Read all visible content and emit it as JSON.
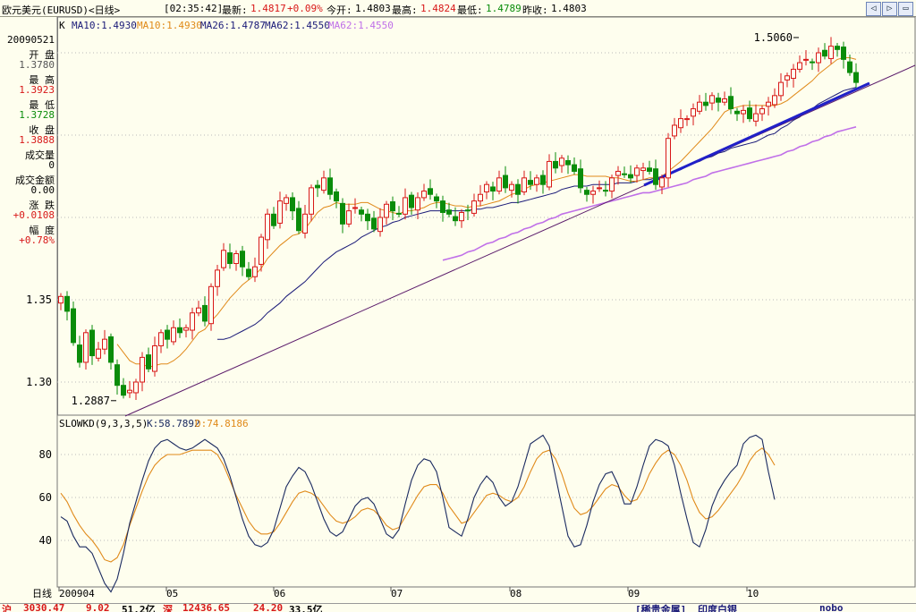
{
  "titlebar": {
    "title": "欧元美元(EURUSD)<日线>",
    "time": "[02:35:42]",
    "latest_label": "最新:",
    "latest_value": "1.4817",
    "change": "+0.09%",
    "open_label": "今开:",
    "open_value": "1.4803",
    "high_label": "最高:",
    "high_value": "1.4824",
    "low_label": "最低:",
    "low_value": "1.4789",
    "prev_label": "昨收:",
    "prev_value": "1.4803",
    "btn_back": "◁",
    "btn_fwd": "▷",
    "btn_close": "▭"
  },
  "legend": {
    "k": "K",
    "ma10a": "MA10:1.4930",
    "ma10b": "MA10:1.4930",
    "ma26": "MA26:1.4787",
    "ma62a": "MA62:1.4550",
    "ma62b": "MA62:1.4550"
  },
  "side": {
    "date": "20090521",
    "open_label": "开 盘",
    "open_value": "1.3780",
    "high_label": "最 高",
    "high_value": "1.3923",
    "low_label": "最 低",
    "low_value": "1.3728",
    "close_label": "收 盘",
    "close_value": "1.3888",
    "vol_label": "成交量",
    "vol_value": "0",
    "amount_label": "成交金额",
    "amount_value": "0.00",
    "change_label": "涨 跌",
    "change_value": "+0.0108",
    "range_label": "幅 度",
    "range_value": "+0.78%"
  },
  "indicator": {
    "name": "SLOWKD(9,3,3,5)",
    "k": "K:58.7892",
    "d": "D:74.8186"
  },
  "footer": {
    "axis_label": "日线",
    "months": [
      "200904",
      "05",
      "06",
      "07",
      "08",
      "09",
      "10"
    ]
  },
  "statusbar": {
    "a": "沪",
    "b": "3030.47",
    "c": "9.02",
    "d": "51.2亿",
    "e": "深",
    "f": "12436.65",
    "g": "24.20",
    "h": "33.5亿",
    "i": "[稀贵金属]",
    "j": "印度白银",
    "k": "nobo"
  },
  "colors": {
    "background": "#FEFEEE",
    "up": "#D81818",
    "down": "#0A8C0A",
    "ma10": "#E08A1A",
    "ma26": "#1A1A78",
    "ma62": "#C070E8",
    "kline": "#1A2A60",
    "dline": "#E08A1A",
    "trendline": "#2020C8"
  },
  "chart_data": [
    {
      "type": "candlestick",
      "title": "欧元美元(EURUSD)<日线>",
      "y_ticks": [
        1.3,
        1.35
      ],
      "y_tick_labels": [
        "1.30",
        "1.35"
      ],
      "ylim": [
        1.28,
        1.52
      ],
      "month_labels": [
        "200904",
        "05",
        "06",
        "07",
        "08",
        "09",
        "10"
      ],
      "annotations": [
        {
          "text": "1.5060",
          "value": 1.506,
          "index": 118
        },
        {
          "text": "1.2887",
          "value": 1.2887,
          "index": 9
        }
      ],
      "closes": [
        1.352,
        1.343,
        1.324,
        1.312,
        1.33,
        1.316,
        1.32,
        1.326,
        1.312,
        1.298,
        1.292,
        1.295,
        1.3,
        1.315,
        1.308,
        1.322,
        1.33,
        1.326,
        1.333,
        1.33,
        1.333,
        1.342,
        1.345,
        1.337,
        1.358,
        1.368,
        1.38,
        1.372,
        1.378,
        1.37,
        1.364,
        1.37,
        1.388,
        1.402,
        1.395,
        1.41,
        1.412,
        1.404,
        1.392,
        1.402,
        1.418,
        1.418,
        1.424,
        1.414,
        1.41,
        1.396,
        1.404,
        1.406,
        1.402,
        1.398,
        1.393,
        1.4,
        1.408,
        1.404,
        1.402,
        1.412,
        1.406,
        1.412,
        1.416,
        1.414,
        1.41,
        1.403,
        1.402,
        1.398,
        1.403,
        1.404,
        1.41,
        1.414,
        1.42,
        1.416,
        1.424,
        1.418,
        1.42,
        1.414,
        1.424,
        1.42,
        1.424,
        1.42,
        1.434,
        1.43,
        1.436,
        1.432,
        1.428,
        1.418,
        1.414,
        1.416,
        1.418,
        1.416,
        1.424,
        1.428,
        1.426,
        1.424,
        1.43,
        1.43,
        1.428,
        1.42,
        1.424,
        1.448,
        1.456,
        1.46,
        1.46,
        1.466,
        1.47,
        1.468,
        1.474,
        1.47,
        1.472,
        1.466,
        1.463,
        1.465,
        1.46,
        1.463,
        1.466,
        1.47,
        1.474,
        1.482,
        1.486,
        1.49,
        1.494,
        1.496,
        1.494,
        1.5,
        1.498,
        1.504,
        1.502,
        1.496,
        1.488,
        1.482
      ],
      "ma10": [
        null,
        null,
        null,
        null,
        null,
        null,
        null,
        null,
        null,
        1.323,
        1.318,
        1.313,
        1.311,
        1.311,
        1.309,
        1.31,
        1.311,
        1.311,
        1.313,
        1.316,
        1.32,
        1.325,
        1.33,
        1.332,
        1.337,
        1.341,
        1.346,
        1.351,
        1.355,
        1.359,
        1.362,
        1.365,
        1.369,
        1.375,
        1.379,
        1.383,
        1.386,
        1.389,
        1.39,
        1.393,
        1.398,
        1.403,
        1.406,
        1.407,
        1.409,
        1.408,
        1.408,
        1.408,
        1.409,
        1.409,
        1.407,
        1.405,
        1.404,
        1.403,
        1.402,
        1.404,
        1.404,
        1.405,
        1.406,
        1.408,
        1.409,
        1.409,
        1.408,
        1.407,
        1.407,
        1.406,
        1.407,
        1.407,
        1.408,
        1.409,
        1.41,
        1.412,
        1.414,
        1.415,
        1.417,
        1.419,
        1.42,
        1.421,
        1.422,
        1.423,
        1.424,
        1.425,
        1.426,
        1.426,
        1.425,
        1.425,
        1.425,
        1.425,
        1.424,
        1.424,
        1.423,
        1.422,
        1.422,
        1.423,
        1.424,
        1.424,
        1.425,
        1.428,
        1.431,
        1.434,
        1.438,
        1.442,
        1.446,
        1.45,
        1.454,
        1.459,
        1.464,
        1.466,
        1.467,
        1.468,
        1.468,
        1.468,
        1.468,
        1.468,
        1.468,
        1.469,
        1.471,
        1.474,
        1.477,
        1.48,
        1.483,
        1.487,
        1.49,
        1.493,
        1.496,
        1.497,
        1.497,
        1.496
      ],
      "ma26": [
        null,
        null,
        null,
        null,
        null,
        null,
        null,
        null,
        null,
        null,
        null,
        null,
        null,
        null,
        null,
        null,
        null,
        null,
        null,
        null,
        null,
        null,
        null,
        null,
        null,
        1.326,
        1.326,
        1.327,
        1.329,
        1.331,
        1.333,
        1.335,
        1.338,
        1.342,
        1.345,
        1.348,
        1.352,
        1.355,
        1.358,
        1.361,
        1.365,
        1.369,
        1.373,
        1.376,
        1.379,
        1.381,
        1.383,
        1.385,
        1.388,
        1.39,
        1.392,
        1.394,
        1.395,
        1.397,
        1.398,
        1.4,
        1.401,
        1.402,
        1.403,
        1.404,
        1.404,
        1.404,
        1.404,
        1.404,
        1.404,
        1.404,
        1.405,
        1.405,
        1.406,
        1.406,
        1.407,
        1.408,
        1.409,
        1.409,
        1.41,
        1.411,
        1.412,
        1.413,
        1.414,
        1.415,
        1.417,
        1.418,
        1.419,
        1.419,
        1.419,
        1.42,
        1.42,
        1.42,
        1.42,
        1.421,
        1.421,
        1.421,
        1.422,
        1.423,
        1.423,
        1.424,
        1.424,
        1.426,
        1.428,
        1.429,
        1.431,
        1.433,
        1.434,
        1.436,
        1.437,
        1.439,
        1.44,
        1.442,
        1.443,
        1.444,
        1.445,
        1.446,
        1.448,
        1.45,
        1.451,
        1.454,
        1.456,
        1.459,
        1.461,
        1.464,
        1.466,
        1.469,
        1.471,
        1.473,
        1.475,
        1.477,
        1.478,
        1.479
      ],
      "ma62": [
        null,
        null,
        null,
        null,
        null,
        null,
        null,
        null,
        null,
        null,
        null,
        null,
        null,
        null,
        null,
        null,
        null,
        null,
        null,
        null,
        null,
        null,
        null,
        null,
        null,
        null,
        null,
        null,
        null,
        null,
        null,
        null,
        null,
        null,
        null,
        null,
        null,
        null,
        null,
        null,
        null,
        null,
        null,
        null,
        null,
        null,
        null,
        null,
        null,
        null,
        null,
        null,
        null,
        null,
        null,
        null,
        null,
        null,
        null,
        null,
        null,
        1.374,
        1.375,
        1.376,
        1.377,
        1.379,
        1.38,
        1.382,
        1.384,
        1.385,
        1.387,
        1.388,
        1.39,
        1.391,
        1.393,
        1.394,
        1.396,
        1.397,
        1.399,
        1.4,
        1.402,
        1.403,
        1.404,
        1.405,
        1.406,
        1.407,
        1.408,
        1.409,
        1.41,
        1.411,
        1.412,
        1.413,
        1.414,
        1.415,
        1.415,
        1.416,
        1.417,
        1.418,
        1.419,
        1.42,
        1.421,
        1.423,
        1.424,
        1.425,
        1.427,
        1.428,
        1.429,
        1.43,
        1.431,
        1.432,
        1.433,
        1.434,
        1.435,
        1.436,
        1.437,
        1.438,
        1.44,
        1.441,
        1.443,
        1.444,
        1.446,
        1.447,
        1.449,
        1.45,
        1.452,
        1.453,
        1.454,
        1.455
      ]
    },
    {
      "type": "line",
      "title": "SLOWKD(9,3,3,5)",
      "y_ticks": [
        40,
        60,
        80
      ],
      "ylim": [
        10,
        100
      ],
      "series": [
        {
          "name": "K",
          "values": [
            51,
            49,
            42,
            37,
            37,
            34,
            27,
            20,
            16,
            22,
            34,
            48,
            58,
            68,
            77,
            83,
            86,
            87,
            85,
            83,
            82,
            83,
            85,
            87,
            85,
            83,
            78,
            70,
            60,
            50,
            42,
            38,
            37,
            39,
            45,
            55,
            65,
            70,
            74,
            72,
            66,
            58,
            50,
            44,
            42,
            44,
            50,
            56,
            59,
            60,
            57,
            50,
            43,
            41,
            45,
            57,
            68,
            75,
            78,
            77,
            72,
            60,
            46,
            44,
            42,
            50,
            60,
            66,
            70,
            67,
            60,
            56,
            58,
            65,
            75,
            85,
            87,
            89,
            84,
            70,
            56,
            42,
            37,
            38,
            47,
            58,
            66,
            71,
            72,
            66,
            57,
            57,
            65,
            75,
            84,
            87,
            86,
            84,
            75,
            62,
            50,
            39,
            37,
            45,
            56,
            63,
            68,
            72,
            75,
            85,
            88,
            89,
            87,
            72,
            59
          ]
        },
        {
          "name": "D",
          "values": [
            62,
            58,
            52,
            47,
            43,
            40,
            36,
            31,
            30,
            32,
            38,
            47,
            55,
            63,
            70,
            75,
            78,
            80,
            80,
            80,
            81,
            82,
            82,
            82,
            82,
            80,
            75,
            68,
            61,
            55,
            49,
            45,
            43,
            43,
            44,
            48,
            53,
            58,
            62,
            63,
            62,
            60,
            56,
            52,
            49,
            48,
            49,
            51,
            54,
            55,
            54,
            51,
            47,
            45,
            46,
            51,
            56,
            61,
            65,
            66,
            66,
            62,
            56,
            52,
            48,
            49,
            53,
            57,
            61,
            62,
            61,
            59,
            58,
            60,
            65,
            72,
            78,
            81,
            82,
            78,
            71,
            62,
            55,
            52,
            53,
            56,
            60,
            64,
            66,
            65,
            61,
            58,
            59,
            64,
            71,
            76,
            80,
            82,
            80,
            75,
            68,
            59,
            53,
            50,
            51,
            54,
            58,
            62,
            66,
            71,
            77,
            81,
            83,
            80,
            75
          ]
        }
      ],
      "month_labels": [
        "200904",
        "05",
        "06",
        "07",
        "08",
        "09",
        "10"
      ],
      "xlabel": "日线"
    }
  ]
}
